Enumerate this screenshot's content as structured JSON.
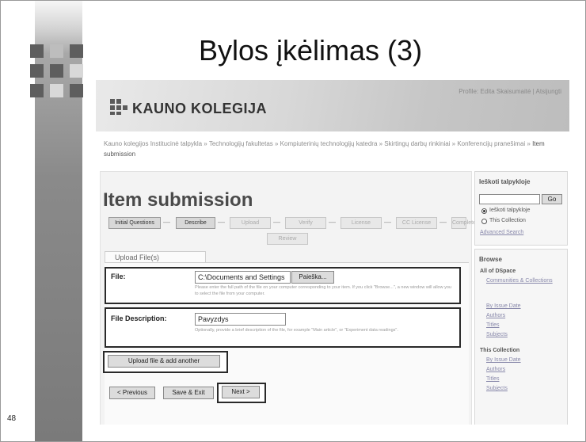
{
  "slide": {
    "title": "Bylos įkėlimas (3)",
    "number": "48"
  },
  "colors": {
    "tile_dark": "#5e5e5e",
    "tile_light": "#d8d8d8",
    "highlight_border": "#2a2a2a"
  },
  "site": {
    "logo_icon": "grid-squares-icon",
    "logo_text": "KAUNO KOLEGIJA",
    "profile_links": "Profile: Edita Skaisumaitė | Atsijungti"
  },
  "breadcrumbs": {
    "trail": "Kauno kolegijos Institucinė talpykla  »  Technologijų fakultetas  »  Kompiuterinių technologijų katedra  »  Skirtingų darbų rinkiniai  »  Konferencijų pranešimai  »",
    "current": "Item submission"
  },
  "page": {
    "heading": "Item submission",
    "steps": [
      "Initial Questions",
      "Describe",
      "Upload",
      "Verify",
      "License",
      "CC License",
      "Complete",
      "Review"
    ],
    "tab_label": "Upload File(s)"
  },
  "form": {
    "file_label": "File:",
    "file_value": "C:\\Documents and Settings",
    "browse_label": "Paieška...",
    "file_hint": "Please enter the full path of the file on your computer corresponding to your item. If you click \"Browse...\", a new window will allow you to select the file from your computer.",
    "desc_label": "File Description:",
    "desc_value": "Pavyzdys",
    "desc_hint": "Optionally, provide a brief description of the file, for example \"Main article\", or \"Experiment data readings\".",
    "upload_button": "Upload file & add another",
    "prev_button": "< Previous",
    "save_button": "Save & Exit",
    "next_button": "Next >"
  },
  "sidebar": {
    "search_title": "Ieškoti talpykloje",
    "go_label": "Go",
    "scope_all": "Ieškoti talpykloje",
    "scope_collection": "This Collection",
    "advanced": "Advanced Search",
    "browse_title": "Browse",
    "all_dspace": "All of DSpace",
    "all_links": [
      "Communities & Collections",
      "By Issue Date",
      "Authors",
      "Titles",
      "Subjects"
    ],
    "this_collection": "This Collection",
    "coll_links": [
      "By Issue Date",
      "Authors",
      "Titles",
      "Subjects"
    ]
  }
}
